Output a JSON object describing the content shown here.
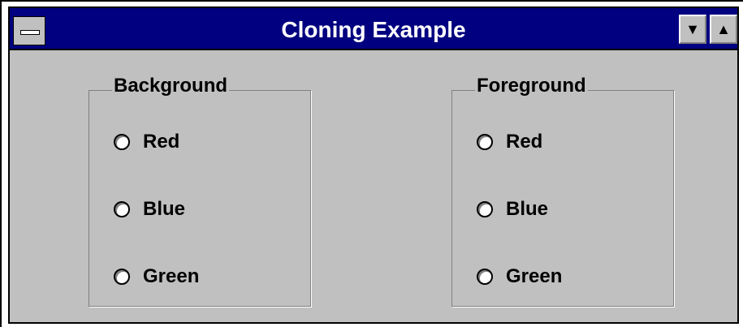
{
  "window": {
    "title": "Cloning Example",
    "minimize_glyph": "▼",
    "maximize_glyph": "▲"
  },
  "groups": [
    {
      "legend": "Background",
      "options": [
        "Red",
        "Blue",
        "Green"
      ]
    },
    {
      "legend": "Foreground",
      "options": [
        "Red",
        "Blue",
        "Green"
      ]
    }
  ],
  "colors": {
    "titlebar": "#000080",
    "face": "#c0c0c0"
  }
}
